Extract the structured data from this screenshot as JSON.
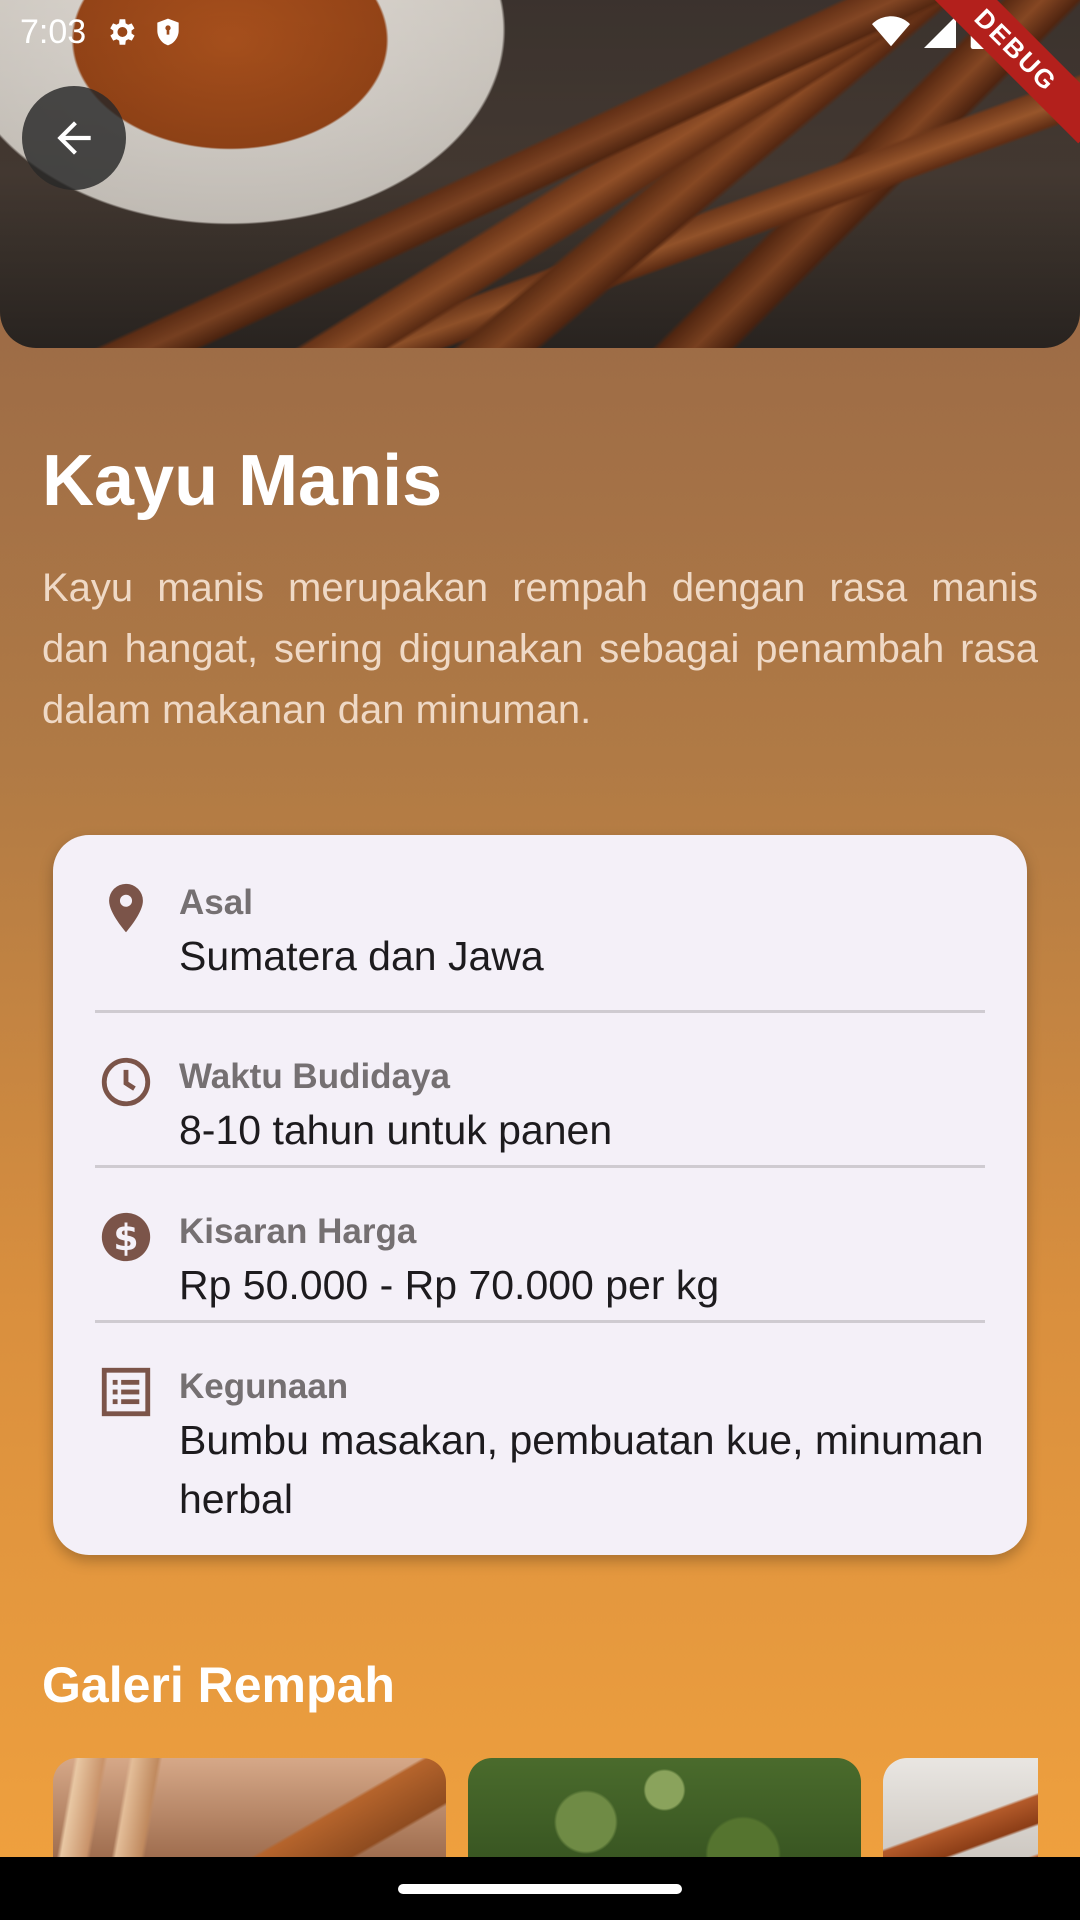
{
  "status_bar": {
    "time": "7:03",
    "left_icons": [
      "gear-icon",
      "shield-icon"
    ],
    "right_icons": [
      "wifi-icon",
      "cell-signal-icon",
      "battery-icon"
    ]
  },
  "debug_banner": "DEBUG",
  "header": {
    "back_icon": "arrow-back-icon"
  },
  "spice": {
    "name": "Kayu Manis",
    "description": "Kayu manis merupakan rempah dengan rasa manis dan hangat, sering digunakan sebagai penambah rasa dalam makanan dan minuman."
  },
  "info": [
    {
      "icon": "location-pin-icon",
      "label": "Asal",
      "value": "Sumatera dan Jawa"
    },
    {
      "icon": "clock-icon",
      "label": "Waktu Budidaya",
      "value": "8-10 tahun untuk panen"
    },
    {
      "icon": "dollar-icon",
      "label": "Kisaran Harga",
      "value": "Rp 50.000 - Rp 70.000 per kg"
    },
    {
      "icon": "list-icon",
      "label": "Kegunaan",
      "value": "Bumbu masakan, pembuatan kue, minuman herbal"
    }
  ],
  "gallery": {
    "title": "Galeri Rempah",
    "images": [
      "cinnamon-sticks-image",
      "cinnamon-tree-image",
      "cinnamon-bundle-image"
    ]
  },
  "colors": {
    "accent_icon": "#7b5449",
    "card_bg": "#f4f0f8",
    "debug_red": "#b3201c"
  }
}
